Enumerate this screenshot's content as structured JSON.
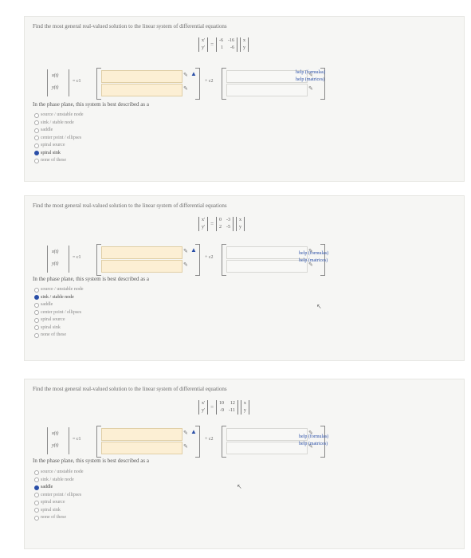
{
  "problems": [
    {
      "prompt": "Find the most general real-valued solution to the linear system of differential equations",
      "system": {
        "lhs": [
          "x'",
          "y'"
        ],
        "matrix": [
          [
            "-6",
            "-16"
          ],
          [
            "1",
            "-6"
          ]
        ],
        "rhs": [
          "x",
          "y"
        ]
      },
      "solution_vec": [
        "x(t)",
        "y(t)"
      ],
      "c1_label": "= c1",
      "c2_label": "+ c2",
      "help": [
        "help (formulas)",
        "help (matrices)"
      ],
      "question": "In the phase plane, this system is best described as a",
      "options": [
        "source / unstable node",
        "sink / stable node",
        "saddle",
        "center point / ellipses",
        "spiral source",
        "spiral sink",
        "none of these"
      ],
      "selected": 5
    },
    {
      "prompt": "Find the most general real-valued solution to the linear system of differential equations",
      "system": {
        "lhs": [
          "x'",
          "y'"
        ],
        "matrix": [
          [
            "0",
            "-3"
          ],
          [
            "2",
            "-5"
          ]
        ],
        "rhs": [
          "x",
          "y"
        ]
      },
      "solution_vec": [
        "x(t)",
        "y(t)"
      ],
      "c1_label": "= c1",
      "c2_label": "+ c2",
      "help": [
        "help (formulas)",
        "help (matrices)"
      ],
      "question": "In the phase plane, this system is best described as a",
      "options": [
        "source / unstable node",
        "sink / stable node",
        "saddle",
        "center point / ellipses",
        "spiral source",
        "spiral sink",
        "none of these"
      ],
      "selected": 1
    },
    {
      "prompt": "Find the most general real-valued solution to the linear system of differential equations",
      "system": {
        "lhs": [
          "x'",
          "y'"
        ],
        "matrix": [
          [
            "10",
            "12"
          ],
          [
            "-9",
            "-11"
          ]
        ],
        "rhs": [
          "x",
          "y"
        ]
      },
      "solution_vec": [
        "x(t)",
        "y(t)"
      ],
      "c1_label": "= c1",
      "c2_label": "+ c2",
      "help": [
        "help (formulas)",
        "help (matrices)"
      ],
      "question": "In the phase plane, this system is best described as a",
      "options": [
        "source / unstable node",
        "sink / stable node",
        "saddle",
        "center point / ellipses",
        "spiral source",
        "spiral sink",
        "none of these"
      ],
      "selected": 2
    }
  ],
  "icons": {
    "pencil": "pencil-icon",
    "warning": "warning-icon",
    "cursor": "mouse-cursor-icon"
  },
  "colors": {
    "answer_field": "#fcefd4",
    "link": "#2a4fa7",
    "panel": "#f6f6f4"
  }
}
